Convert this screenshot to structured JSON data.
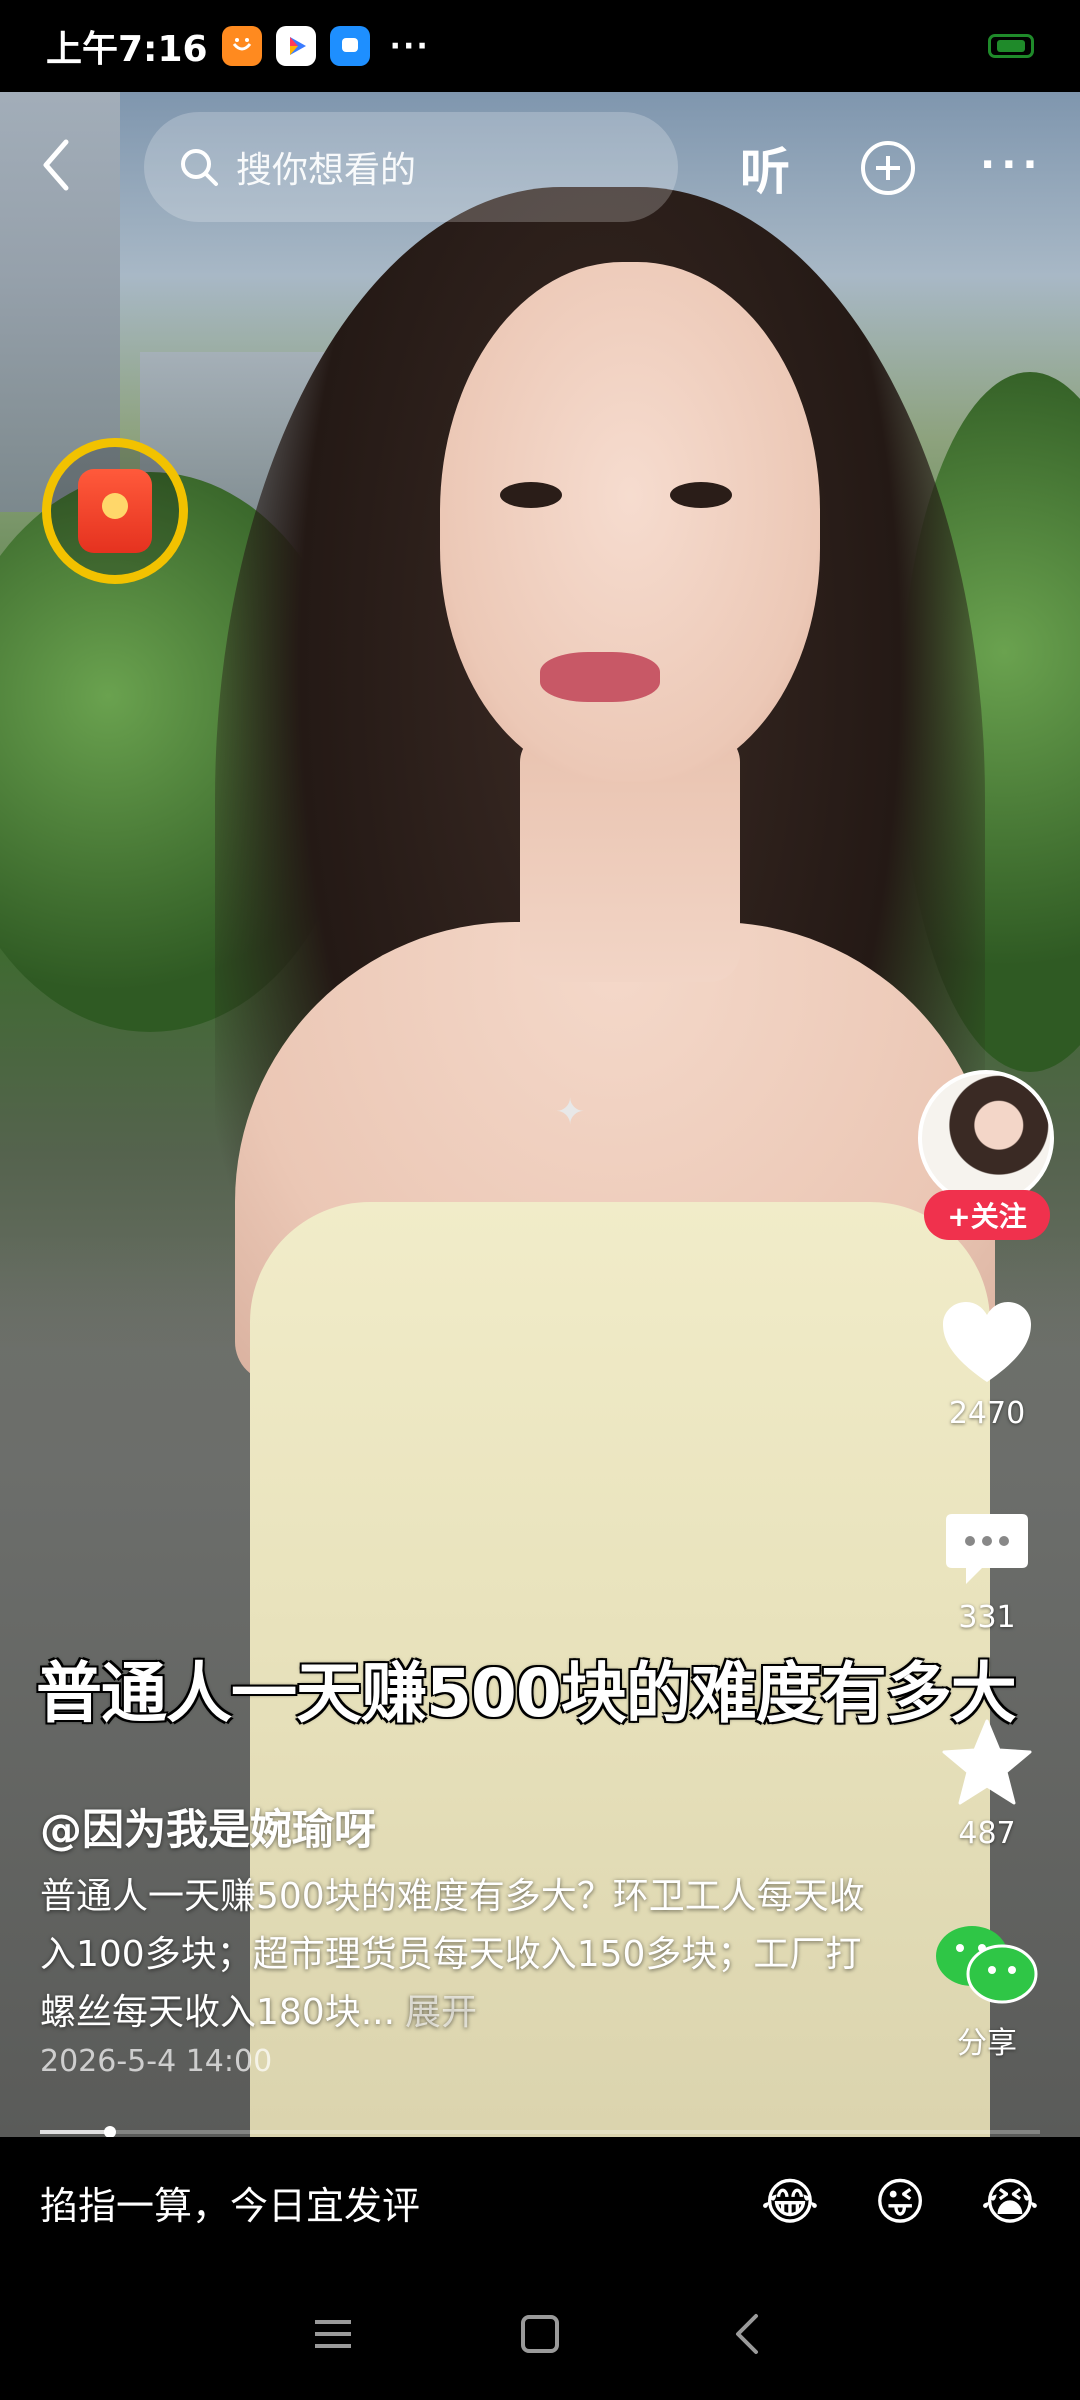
{
  "status_bar": {
    "time": "上午7:16",
    "more": "···",
    "app_icons": [
      "taobao-icon",
      "video-player-icon",
      "message-app-icon"
    ]
  },
  "top_bar": {
    "search_placeholder": "搜你想看的",
    "listen_label": "听",
    "more_label": "···"
  },
  "sidebar": {
    "follow_label": "+关注",
    "like_count": "2470",
    "comment_count": "331",
    "favorite_count": "487",
    "share_label": "分享"
  },
  "video": {
    "overlay_title": "普通人一天赚500块的难度有多大",
    "author": "@因为我是婉瑜呀",
    "description": "普通人一天赚500块的难度有多大？环卫工人每天收入100多块；超市理货员每天收入150多块；工厂打螺丝每天收入180块...",
    "expand_label": "展开",
    "date": "2026-5-4 14:00",
    "progress": 0.07
  },
  "comment_bar": {
    "placeholder": "掐指一算，今日宜发评",
    "emojis": [
      "😂",
      "😜",
      "😭"
    ]
  },
  "colors": {
    "follow_red": "#f0314d",
    "share_green": "#2fc646",
    "redpack_ring": "#f2c200"
  }
}
